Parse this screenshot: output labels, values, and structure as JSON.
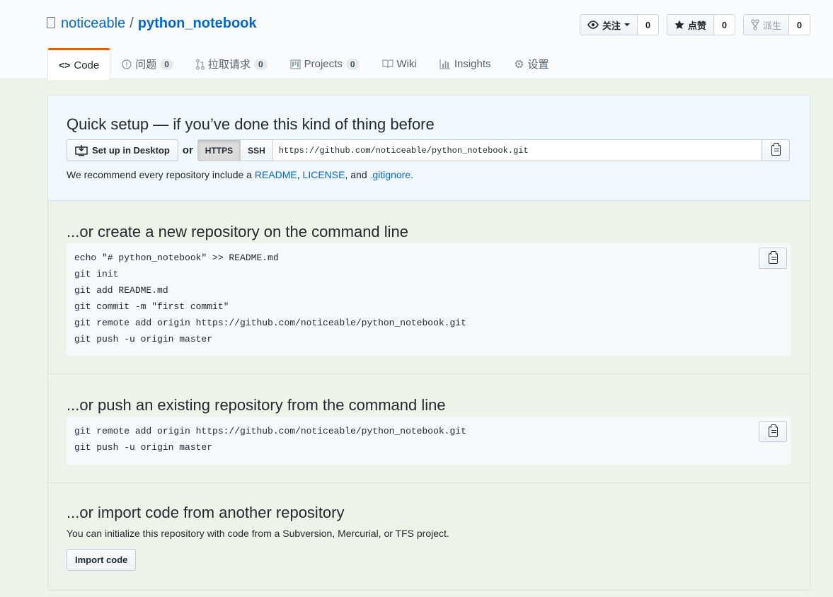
{
  "repo": {
    "owner": "noticeable",
    "separator": "/",
    "name": "python_notebook"
  },
  "actions": [
    {
      "icon": "eye-icon",
      "label": "关注",
      "count": "0"
    },
    {
      "icon": "star-icon",
      "label": "点赞",
      "count": "0"
    },
    {
      "icon": "fork-icon",
      "label": "派生",
      "count": "0"
    }
  ],
  "tabs": [
    {
      "icon": "code-icon",
      "label": "Code",
      "counter": null,
      "selected": true
    },
    {
      "icon": "issue-icon",
      "label": "问题",
      "counter": "0"
    },
    {
      "icon": "pull-request-icon",
      "label": "拉取请求",
      "counter": "0"
    },
    {
      "icon": "project-icon",
      "label": "Projects",
      "counter": "0"
    },
    {
      "icon": "book-icon",
      "label": "Wiki",
      "counter": null
    },
    {
      "icon": "graph-icon",
      "label": "Insights",
      "counter": null
    },
    {
      "icon": "gear-icon",
      "label": "设置",
      "counter": null
    }
  ],
  "quick_setup": {
    "title": "Quick setup — if you’ve done this kind of thing before",
    "desktop_label": "Set up in Desktop",
    "or": "or",
    "https_label": "HTTPS",
    "ssh_label": "SSH",
    "url": "https://github.com/noticeable/python_notebook.git",
    "recommend_prefix": "We recommend every repository include a ",
    "readme": "README",
    "comma1": ", ",
    "license": "LICENSE",
    "and": ", and ",
    "gitignore": ".gitignore",
    "period": "."
  },
  "create_new": {
    "title": "...or create a new repository on the command line",
    "lines": [
      "echo \"# python_notebook\" >> README.md",
      "git init",
      "git add README.md",
      "git commit -m \"first commit\"",
      "git remote add origin https://github.com/noticeable/python_notebook.git",
      "git push -u origin master"
    ]
  },
  "push_existing": {
    "title": "...or push an existing repository from the command line",
    "lines": [
      "git remote add origin https://github.com/noticeable/python_notebook.git",
      "git push -u origin master"
    ]
  },
  "import": {
    "title": "...or import code from another repository",
    "description": "You can initialize this repository with code from a Subversion, Mercurial, or TFS project.",
    "button": "Import code"
  }
}
